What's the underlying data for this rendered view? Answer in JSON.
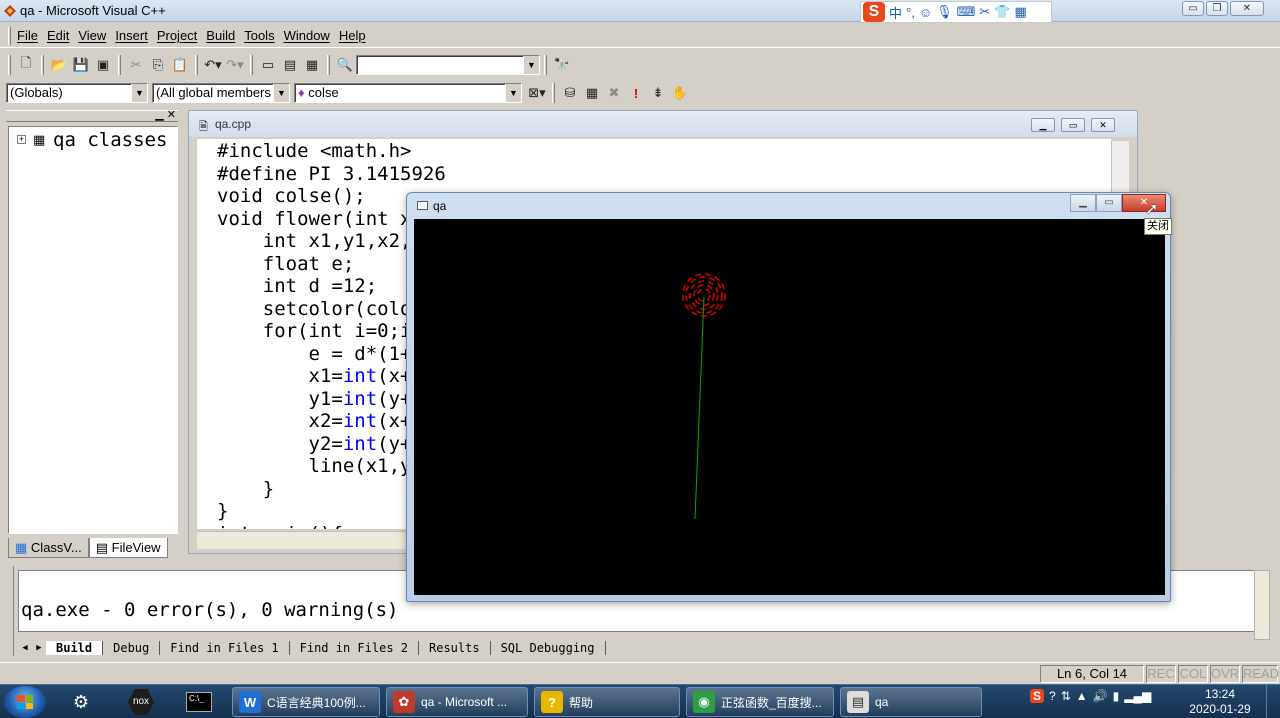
{
  "window": {
    "title": "qa - Microsoft Visual C++",
    "controls": [
      "▭",
      "❐",
      "✕"
    ]
  },
  "ime": {
    "logo": "S",
    "items": [
      "中",
      "°,",
      "☺",
      "🎙",
      "⌨",
      "✂",
      "👕",
      "▦"
    ]
  },
  "menu": [
    "File",
    "Edit",
    "View",
    "Insert",
    "Project",
    "Build",
    "Tools",
    "Window",
    "Help"
  ],
  "wizard_bar": {
    "scope": "(Globals)",
    "filter": "(All global members",
    "member": "colse",
    "member_icon": "♦"
  },
  "workspace": {
    "tree_root": "qa classes",
    "tabs": [
      "ClassV...",
      "FileView"
    ],
    "active_tab": 1
  },
  "editor": {
    "file": "qa.cpp",
    "lines": [
      [
        {
          "t": "#include <math.h>"
        }
      ],
      [
        {
          "t": "#define PI 3.1415926"
        }
      ],
      [
        {
          "t": "void colse();"
        }
      ],
      [
        {
          "t": "void flower(int x"
        }
      ],
      [
        {
          "t": "    int x1,y1,x2,"
        }
      ],
      [
        {
          "t": "    float e;"
        }
      ],
      [
        {
          "t": "    int d =12;"
        }
      ],
      [
        {
          "t": "    setcolor(colo"
        }
      ],
      [
        {
          "t": "    for(int i=0;i"
        }
      ],
      [
        {
          "t": "        e = d*(1+"
        }
      ],
      [
        {
          "t": "        x1="
        },
        {
          "t": "int",
          "k": true
        },
        {
          "t": "(x+"
        }
      ],
      [
        {
          "t": "        y1="
        },
        {
          "t": "int",
          "k": true
        },
        {
          "t": "(y+"
        }
      ],
      [
        {
          "t": "        x2="
        },
        {
          "t": "int",
          "k": true
        },
        {
          "t": "(x+"
        }
      ],
      [
        {
          "t": "        y2="
        },
        {
          "t": "int",
          "k": true
        },
        {
          "t": "(y+"
        }
      ],
      [
        {
          "t": "        line(x1,y"
        }
      ],
      [
        {
          "t": "    }"
        }
      ],
      [
        {
          "t": "}"
        }
      ],
      [
        {
          "t": "int main(){"
        }
      ]
    ]
  },
  "program_window": {
    "title": "qa",
    "close_tooltip": "关闭"
  },
  "output": {
    "message": "qa.exe - 0 error(s), 0 warning(s)",
    "tabs": [
      "Build",
      "Debug",
      "Find in Files 1",
      "Find in Files 2",
      "Results",
      "SQL Debugging"
    ],
    "active_tab": 0
  },
  "status": {
    "position": "Ln 6, Col 14",
    "indicators": [
      "REC",
      "COL",
      "OVR",
      "READ"
    ]
  },
  "taskbar": {
    "tasks": [
      {
        "icon": "W",
        "label": "C语言经典100例...",
        "color": "#1f6fd6"
      },
      {
        "icon": "✿",
        "label": "qa - Microsoft ...",
        "color": "#c0392b"
      },
      {
        "icon": "?",
        "label": "帮助",
        "color": "#e6b800"
      },
      {
        "icon": "◉",
        "label": "正弦函数_百度搜...",
        "color": "#2e9e44"
      },
      {
        "icon": "▤",
        "label": "qa",
        "color": "#dddddd"
      }
    ],
    "clock_time": "13:24",
    "clock_date": "2020-01-29"
  },
  "colors": {
    "keyword": "#0000ff",
    "flower_petals": "#cc0000",
    "flower_stem": "#00aa00",
    "canvas": "#000000"
  }
}
